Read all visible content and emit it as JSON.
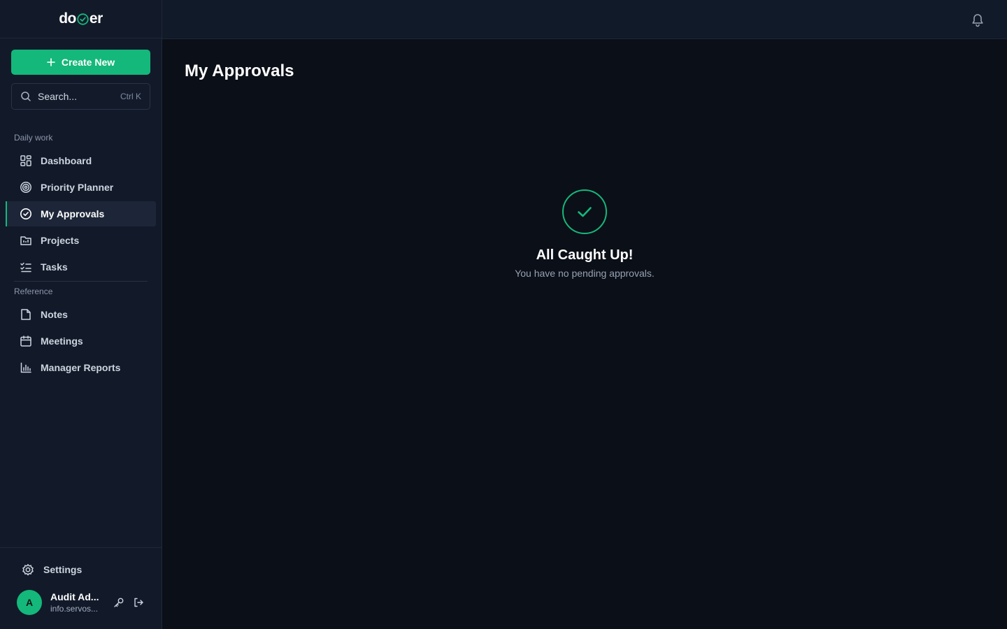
{
  "brand": {
    "logo_left": "do",
    "logo_right": "er",
    "accent": "#14b87a"
  },
  "sidebar": {
    "create_label": "Create New",
    "search": {
      "placeholder": "Search...",
      "shortcut": "Ctrl K"
    },
    "sections": {
      "daily": "Daily work",
      "reference": "Reference"
    },
    "items": [
      {
        "label": "Dashboard",
        "icon": "dashboard-grid-icon"
      },
      {
        "label": "Priority Planner",
        "icon": "target-icon"
      },
      {
        "label": "My Approvals",
        "icon": "check-circle-icon",
        "active": true
      },
      {
        "label": "Projects",
        "icon": "project-board-icon"
      },
      {
        "label": "Tasks",
        "icon": "task-list-icon"
      },
      {
        "label": "Notes",
        "icon": "note-file-icon"
      },
      {
        "label": "Meetings",
        "icon": "calendar-icon"
      },
      {
        "label": "Manager Reports",
        "icon": "bar-chart-icon"
      }
    ],
    "settings_label": "Settings",
    "user": {
      "initial": "A",
      "name": "Audit Ad...",
      "email": "info.servos..."
    }
  },
  "main": {
    "title": "My Approvals",
    "empty_title": "All Caught Up!",
    "empty_subtitle": "You have no pending approvals."
  }
}
